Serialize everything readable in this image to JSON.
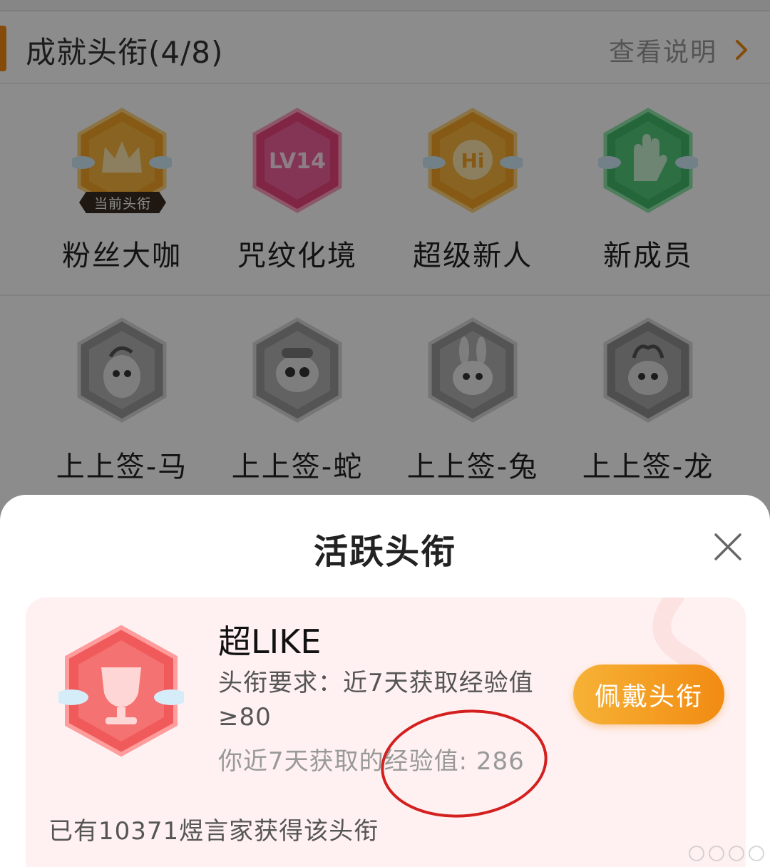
{
  "header": {
    "title": "成就头衔(4/8)",
    "explain_link": "查看说明"
  },
  "badges_row1": [
    {
      "label": "粉丝大咖",
      "icon": "crown-icon",
      "color": "#f4a326",
      "tag": "当前头衔"
    },
    {
      "label": "咒纹化境",
      "icon": "lv14-icon",
      "color": "#e9447c",
      "badge_text": "LV14"
    },
    {
      "label": "超级新人",
      "icon": "hi-bubble-icon",
      "color": "#f4a326",
      "badge_text": "Hi"
    },
    {
      "label": "新成员",
      "icon": "hand-icon",
      "color": "#42b86a"
    }
  ],
  "badges_row2": [
    {
      "label": "上上签-马",
      "icon": "horse-icon"
    },
    {
      "label": "上上签-蛇",
      "icon": "snake-icon"
    },
    {
      "label": "上上签-兔",
      "icon": "rabbit-icon"
    },
    {
      "label": "上上签-龙",
      "icon": "dragon-icon"
    }
  ],
  "sheet": {
    "title": "活跃头衔",
    "card": {
      "name": "超LIKE",
      "requirement": "头衔要求：近7天获取经验值≥80",
      "progress": "你近7天获取的经验值: 286",
      "wear_button": "佩戴头衔",
      "owners": "已有10371煜言家获得该头衔",
      "badge_icon": "trophy-icon",
      "badge_color": "#f05a5a"
    }
  },
  "colors": {
    "accent": "#f08a10",
    "button_start": "#f6b236",
    "button_end": "#f28b12",
    "card_bg": "#fff1f1"
  }
}
